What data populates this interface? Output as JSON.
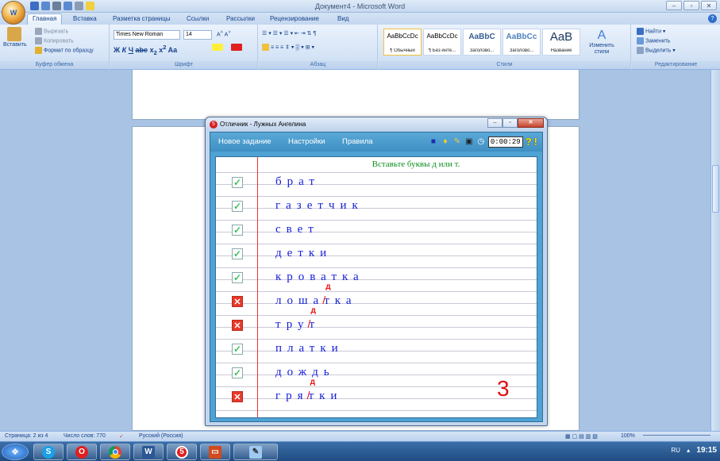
{
  "word": {
    "title": "Документ4 - Microsoft Word",
    "tabs": [
      "Главная",
      "Вставка",
      "Разметка страницы",
      "Ссылки",
      "Рассылки",
      "Рецензирование",
      "Вид"
    ],
    "clipboard": {
      "paste": "Вставить",
      "cut": "Вырезать",
      "copy": "Копировать",
      "format_painter": "Формат по образцу",
      "label": "Буфер обмена"
    },
    "font": {
      "name": "Times New Roman",
      "size": "14",
      "label": "Шрифт"
    },
    "paragraph_label": "Абзац",
    "styles": {
      "items": [
        {
          "sample": "AaBbCcDc",
          "name": "¶ Обычный"
        },
        {
          "sample": "AaBbCcDc",
          "name": "¶ Без инте..."
        },
        {
          "sample": "AaBbC",
          "name": "Заголово..."
        },
        {
          "sample": "AaBbCc",
          "name": "Заголово..."
        },
        {
          "sample": "AaB",
          "name": "Название"
        }
      ],
      "change": "Изменить стили",
      "label": "Стили"
    },
    "editing": {
      "find": "Найти",
      "replace": "Заменить",
      "select": "Выделить",
      "label": "Редактирование"
    },
    "status": {
      "page": "Страница: 2 из 4",
      "words": "Число слов: 770",
      "lang": "Русский (Россия)",
      "zoom": "100%"
    }
  },
  "app": {
    "title": "Отличник - Лужных Ангелина",
    "menu": [
      "Новое задание",
      "Настройки",
      "Правила"
    ],
    "timer": "0:00:29",
    "help": "?",
    "alert": "!",
    "instruction": "Вставьте буквы д или т.",
    "rows": [
      {
        "status": "ok",
        "pre": "брат",
        "wrong": "",
        "fix": "",
        "post": ""
      },
      {
        "status": "ok",
        "pre": "газетчик",
        "wrong": "",
        "fix": "",
        "post": ""
      },
      {
        "status": "ok",
        "pre": "свет",
        "wrong": "",
        "fix": "",
        "post": ""
      },
      {
        "status": "ok",
        "pre": "детки",
        "wrong": "",
        "fix": "",
        "post": ""
      },
      {
        "status": "ok",
        "pre": "кроватка",
        "wrong": "",
        "fix": "",
        "post": ""
      },
      {
        "status": "bad",
        "pre": "лоша",
        "wrong": "т",
        "fix": "д",
        "post": "ка"
      },
      {
        "status": "bad",
        "pre": "тру",
        "wrong": "т",
        "fix": "д",
        "post": ""
      },
      {
        "status": "ok",
        "pre": "платки",
        "wrong": "",
        "fix": "",
        "post": ""
      },
      {
        "status": "ok",
        "pre": "дождь",
        "wrong": "",
        "fix": "",
        "post": ""
      },
      {
        "status": "bad",
        "pre": "гря",
        "wrong": "т",
        "fix": "д",
        "post": "ки"
      }
    ],
    "score": "3"
  },
  "taskbar": {
    "lang": "RU",
    "clock": "19:15"
  }
}
